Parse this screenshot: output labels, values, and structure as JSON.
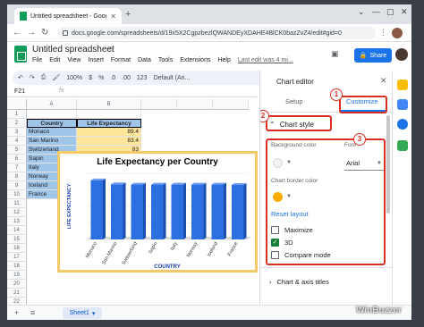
{
  "browser": {
    "tab_title": "Untitled spreadsheet - Google S",
    "url": "docs.google.com/spreadsheets/d/19x5X2CgpzbezlQWANDEyXDAHE4BlCK0bazZvZ4/edit#gid=0"
  },
  "doc": {
    "title": "Untitled spreadsheet",
    "menu": [
      "File",
      "Edit",
      "View",
      "Insert",
      "Format",
      "Data",
      "Tools",
      "Extensions",
      "Help"
    ],
    "last_edit": "Last edit was 4 mi...",
    "share_label": "Share"
  },
  "toolbar": {
    "zoom": "100%",
    "currency": "$",
    "percent": "%",
    "dec1": ".0",
    "dec2": ".00",
    "format123": "123",
    "font": "Default (Ari..."
  },
  "formula_bar": {
    "cell_ref": "F21",
    "fx": "fx"
  },
  "grid": {
    "columns": [
      "A",
      "B"
    ],
    "rows": [
      "1",
      "2",
      "3",
      "4",
      "5",
      "6",
      "7",
      "8",
      "9",
      "10",
      "11",
      "12",
      "13",
      "14",
      "15",
      "16",
      "17",
      "18",
      "19",
      "20",
      "21",
      "22"
    ],
    "header": [
      "Country",
      "Life Expectancy"
    ],
    "data": [
      {
        "country": "Monaco",
        "value": "89.4"
      },
      {
        "country": "San Marino",
        "value": "83.4"
      },
      {
        "country": "Switzerland",
        "value": "83"
      },
      {
        "country": "Sapin",
        "value": ""
      },
      {
        "country": "Italy",
        "value": ""
      },
      {
        "country": "Norway",
        "value": ""
      },
      {
        "country": "Iceland",
        "value": ""
      },
      {
        "country": "France",
        "value": ""
      }
    ]
  },
  "chart_data": {
    "type": "bar",
    "title": "Life Expectancy per Country",
    "xlabel": "COUNTRY",
    "ylabel": "LIFE EXPECTANCY",
    "categories": [
      "Monaco",
      "San Marino",
      "Switzerland",
      "Sapin",
      "Italy",
      "Norway",
      "Iceland",
      "France"
    ],
    "values": [
      89.4,
      83.4,
      83,
      83,
      83,
      83,
      83,
      82.5
    ],
    "bar_color": "#2b6fe0",
    "grid": true
  },
  "editor": {
    "title": "Chart editor",
    "tabs": [
      "Setup",
      "Customize"
    ],
    "section": "Chart style",
    "bg_color_label": "Background color",
    "font_label": "Font",
    "font_value": "Arial",
    "border_label": "Chart border color",
    "border_color": "#f9ab00",
    "reset": "Reset layout",
    "checks": [
      {
        "label": "Maximize",
        "checked": false
      },
      {
        "label": "3D",
        "checked": true
      },
      {
        "label": "Compare mode",
        "checked": false
      }
    ],
    "next_section": "Chart & axis titles"
  },
  "callouts": [
    "1",
    "2",
    "3"
  ],
  "sheet_tab": "Sheet1",
  "watermark": "WinBuzzer"
}
